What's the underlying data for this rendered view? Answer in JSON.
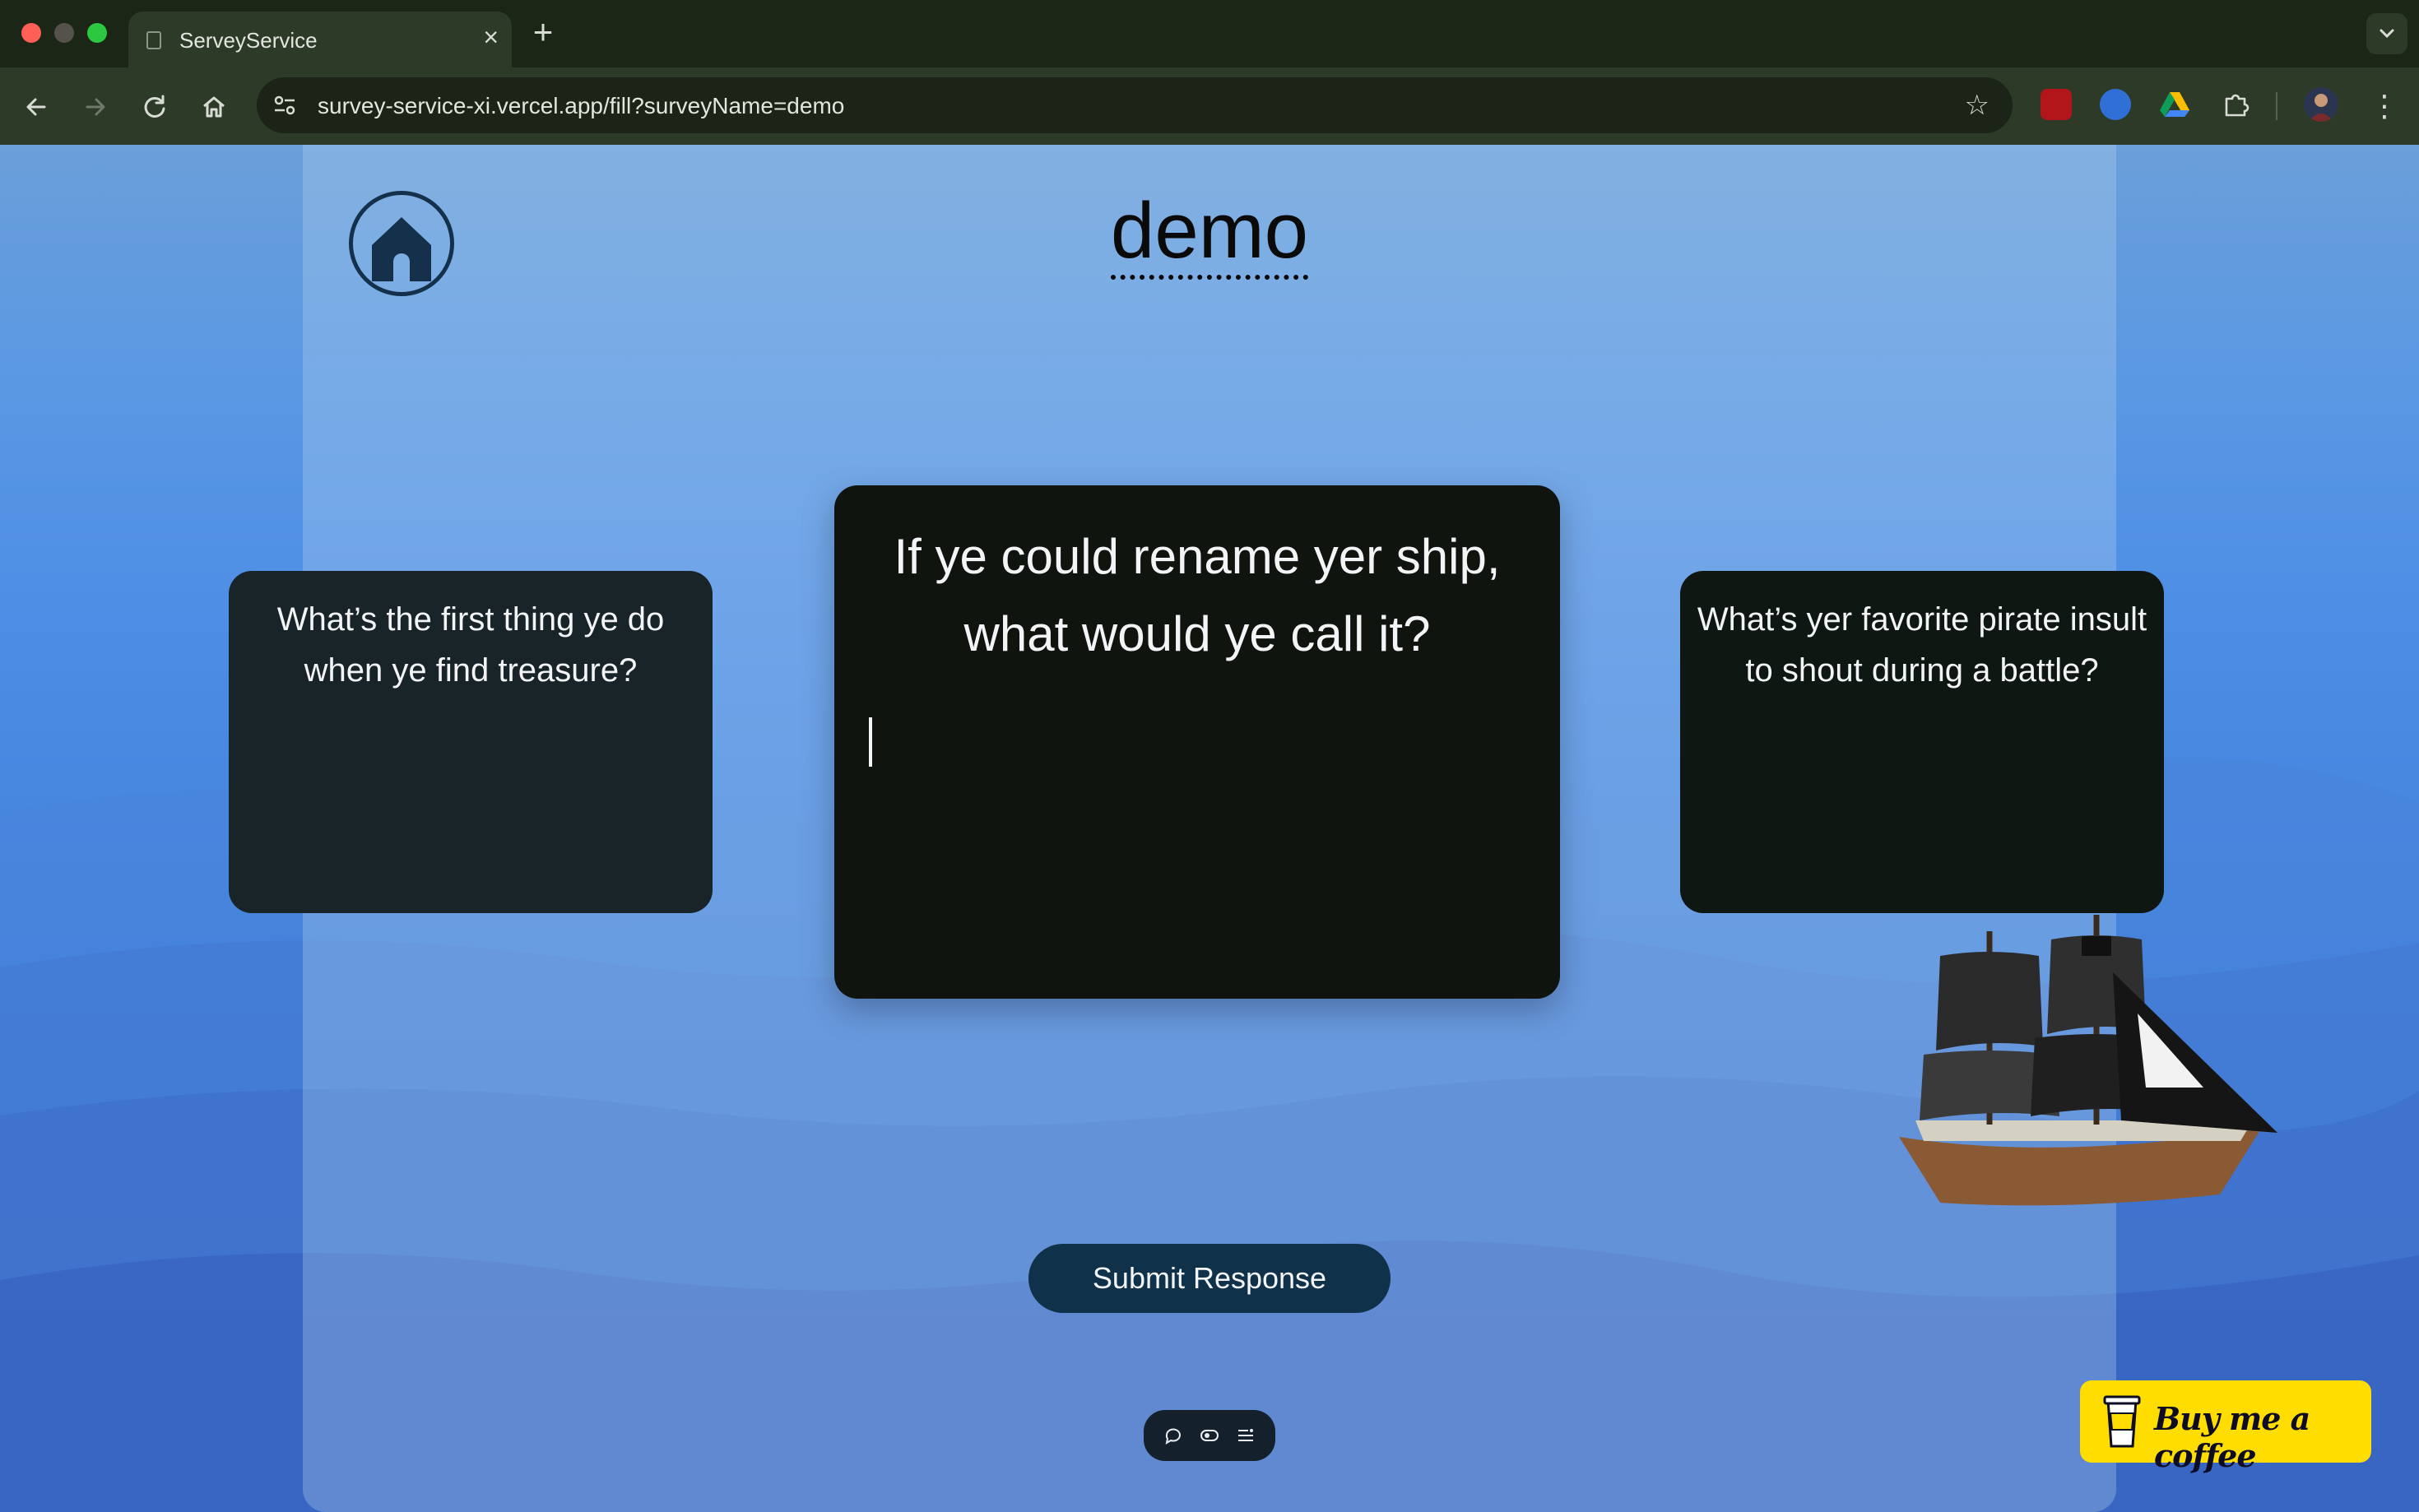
{
  "browser": {
    "tab_title": "ServeyService",
    "new_tab_symbol": "+",
    "url": "survey-service-xi.vercel.app/fill?surveyName=demo"
  },
  "survey": {
    "title": "demo",
    "questions": {
      "previous": "What’s the first thing ye do when ye find treasure?",
      "current": "If ye could rename yer ship, what would ye call it?",
      "next": "What’s yer favorite pirate insult to shout during a battle?"
    },
    "submit_label": "Submit Response"
  },
  "footer": {
    "coffee_label": "Buy me a coffee"
  },
  "colors": {
    "brand_dark": "#0f3149",
    "coffee_yellow": "#ffdd00",
    "card_bg": "#0f140f"
  }
}
